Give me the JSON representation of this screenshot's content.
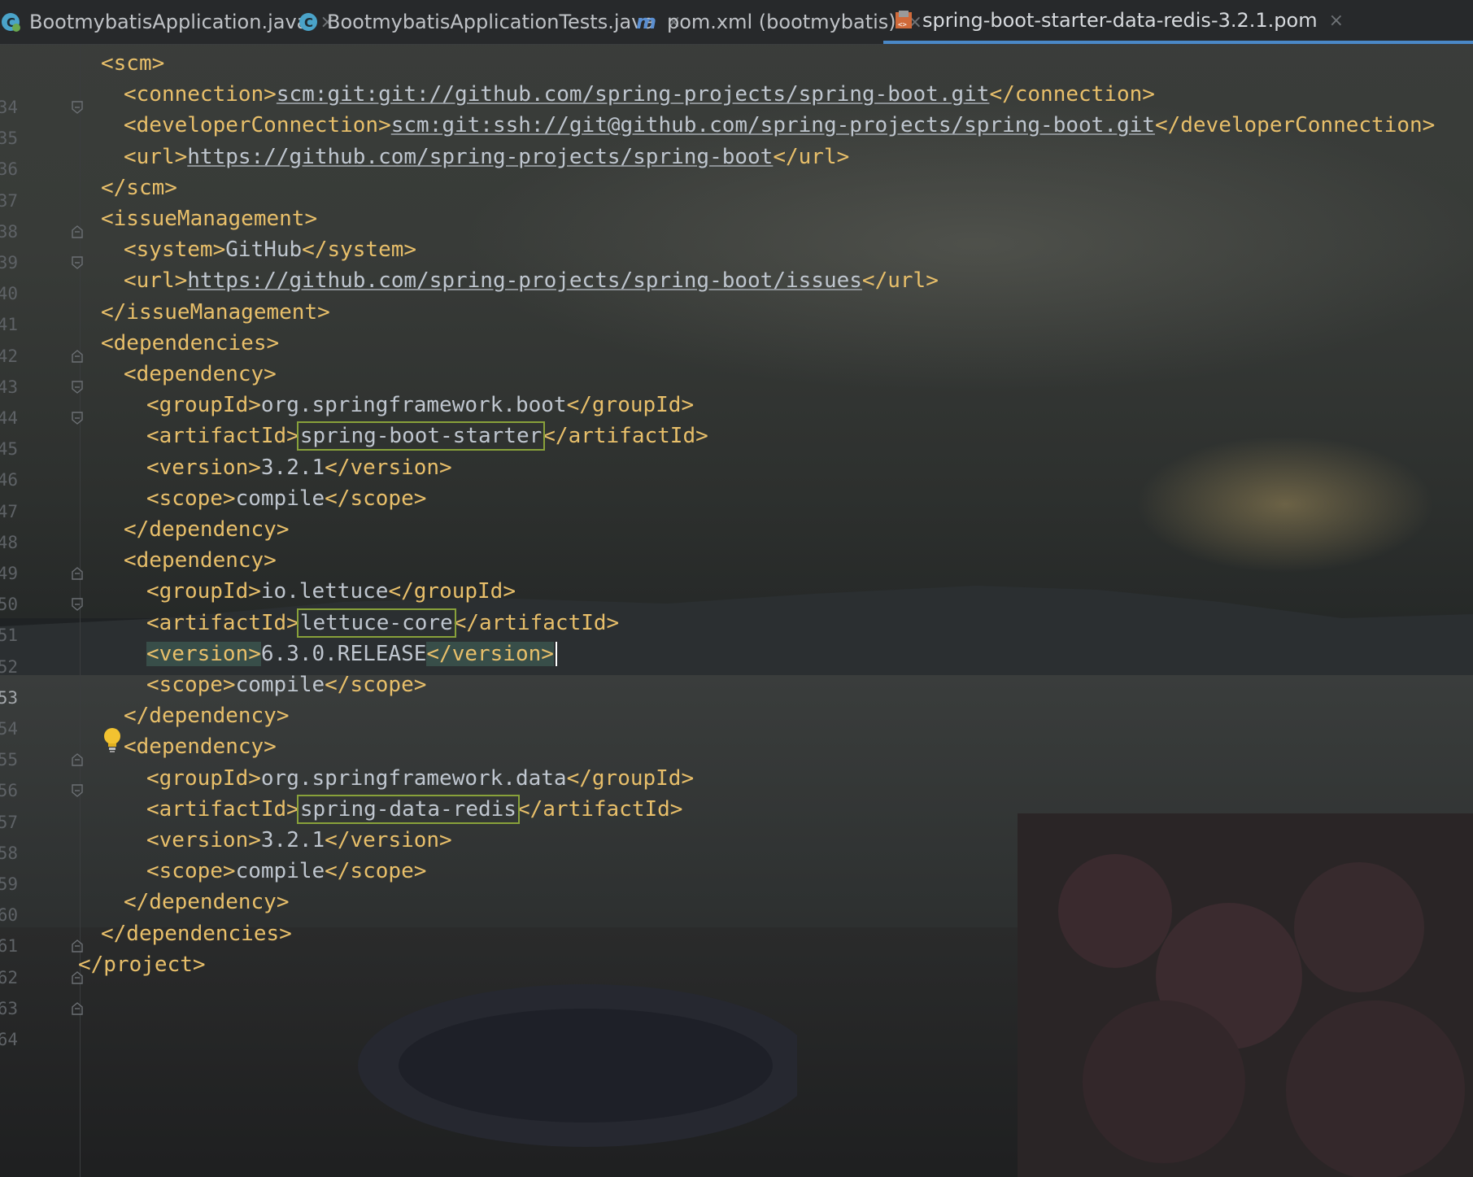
{
  "tabs": [
    {
      "label": "BootmybatisApplication.java",
      "icon": "spring-class-icon",
      "active": false
    },
    {
      "label": "BootmybatisApplicationTests.java",
      "icon": "java-class-icon",
      "active": false
    },
    {
      "label": "pom.xml (bootmybatis)",
      "icon": "maven-icon",
      "active": false
    },
    {
      "label": "spring-boot-starter-data-redis-3.2.1.pom",
      "icon": "xml-file-icon",
      "active": true
    }
  ],
  "tab_close_glyph": "×",
  "current_line": "53",
  "lines": [
    {
      "n": "34",
      "text": "<scm>"
    },
    {
      "n": "35",
      "tag_open": "<connection>",
      "value": "scm:git:git://github.com/spring-projects/spring-boot.git",
      "tag_close": "</connection>"
    },
    {
      "n": "36",
      "tag_open": "<developerConnection>",
      "value": "scm:git:ssh://git@github.com/spring-projects/spring-boot.git",
      "tag_close": "</developerConnection>"
    },
    {
      "n": "37",
      "tag_open": "<url>",
      "value": "https://github.com/spring-projects/spring-boot",
      "tag_close": "</url>"
    },
    {
      "n": "38",
      "text": "</scm>"
    },
    {
      "n": "39",
      "text": "<issueManagement>"
    },
    {
      "n": "40",
      "tag_open": "<system>",
      "value": "GitHub",
      "tag_close": "</system>"
    },
    {
      "n": "41",
      "tag_open": "<url>",
      "value": "https://github.com/spring-projects/spring-boot/issues",
      "tag_close": "</url>"
    },
    {
      "n": "42",
      "text": "</issueManagement>"
    },
    {
      "n": "43",
      "text": "<dependencies>"
    },
    {
      "n": "44",
      "text": "<dependency>"
    },
    {
      "n": "45",
      "tag_open": "<groupId>",
      "value": "org.springframework.boot",
      "tag_close": "</groupId>"
    },
    {
      "n": "46",
      "tag_open": "<artifactId>",
      "value": "spring-boot-starter",
      "tag_close": "</artifactId>"
    },
    {
      "n": "47",
      "tag_open": "<version>",
      "value": "3.2.1",
      "tag_close": "</version>"
    },
    {
      "n": "48",
      "tag_open": "<scope>",
      "value": "compile",
      "tag_close": "</scope>"
    },
    {
      "n": "49",
      "text": "</dependency>"
    },
    {
      "n": "50",
      "text": "<dependency>"
    },
    {
      "n": "51",
      "tag_open": "<groupId>",
      "value": "io.lettuce",
      "tag_close": "</groupId>"
    },
    {
      "n": "52",
      "tag_open": "<artifactId>",
      "value": "lettuce-core",
      "tag_close": "</artifactId>"
    },
    {
      "n": "53",
      "tag_open": "<version>",
      "value": "6.3.0.RELEASE",
      "tag_close": "</version>"
    },
    {
      "n": "54",
      "tag_open": "<scope>",
      "value": "compile",
      "tag_close": "</scope>"
    },
    {
      "n": "55",
      "text": "</dependency>"
    },
    {
      "n": "56",
      "text": "<dependency>"
    },
    {
      "n": "57",
      "tag_open": "<groupId>",
      "value": "org.springframework.data",
      "tag_close": "</groupId>"
    },
    {
      "n": "58",
      "tag_open": "<artifactId>",
      "value": "spring-data-redis",
      "tag_close": "</artifactId>"
    },
    {
      "n": "59",
      "tag_open": "<version>",
      "value": "3.2.1",
      "tag_close": "</version>"
    },
    {
      "n": "60",
      "tag_open": "<scope>",
      "value": "compile",
      "tag_close": "</scope>"
    },
    {
      "n": "61",
      "text": "</dependency>"
    },
    {
      "n": "62",
      "text": "</dependencies>"
    },
    {
      "n": "63",
      "text": "</project>"
    },
    {
      "n": "64",
      "text": ""
    }
  ],
  "colors": {
    "tag": "#e8bf6a",
    "text": "#bfc6cf",
    "accent": "#4a88c7",
    "box": "#88a13a",
    "bulb": "#f2c230"
  }
}
